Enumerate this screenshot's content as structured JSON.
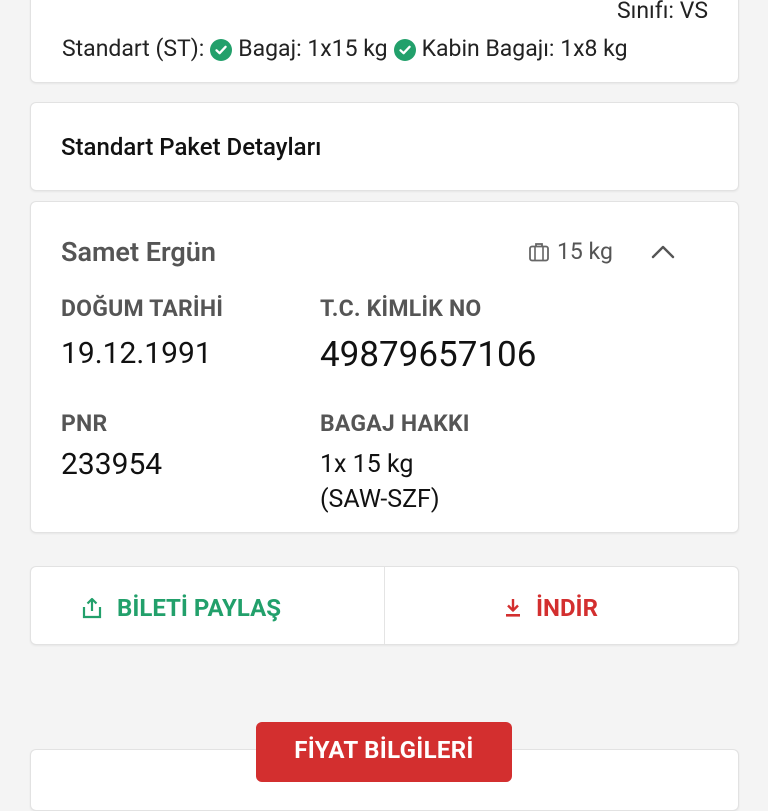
{
  "top_card": {
    "class_text": "Sınıfı: VS",
    "fare_label": "Standart (ST):",
    "baggage_label": "Bagaj: 1x15 kg",
    "cabin_label": "Kabin Bagajı: 1x8 kg"
  },
  "package": {
    "title": "Standart Paket Detayları"
  },
  "passenger": {
    "name": "Samet Ergün",
    "luggage": "15 kg",
    "birth_label": "DOĞUM TARİHİ",
    "birth_value": "19.12.1991",
    "tc_label": "T.C. KİMLİK NO",
    "tc_value": "49879657106",
    "pnr_label": "PNR",
    "pnr_value": "233954",
    "baggage_label": "BAGAJ HAKKI",
    "baggage_value_line1": "1x 15 kg",
    "baggage_value_line2": "(SAW-SZF)"
  },
  "actions": {
    "share_label": "BİLETİ PAYLAŞ",
    "download_label": "İNDİR"
  },
  "price": {
    "tab_label": "FİYAT BİLGİLERİ"
  },
  "colors": {
    "green": "#22a06b",
    "red": "#d32f2f"
  }
}
